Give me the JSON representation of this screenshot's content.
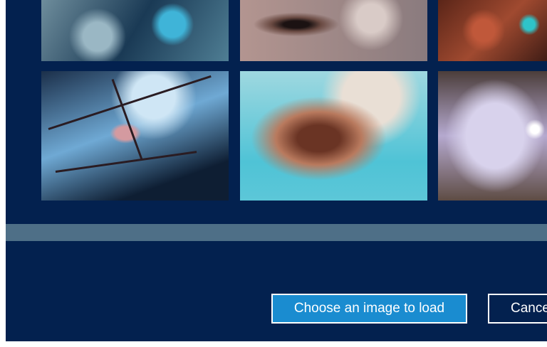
{
  "gallery": {
    "tiles": [
      {
        "name": "image-tile-1",
        "colors": [
          "#6e8d9c",
          "#3fb4d8"
        ]
      },
      {
        "name": "image-tile-2",
        "colors": [
          "#b39590",
          "#1b1212"
        ]
      },
      {
        "name": "image-tile-3",
        "colors": [
          "#a04a30",
          "#2ec4c9"
        ]
      },
      {
        "name": "image-tile-4",
        "colors": [
          "#6fa9d4",
          "#d49aa0"
        ]
      },
      {
        "name": "image-tile-5",
        "colors": [
          "#4fc3d6",
          "#b97a5e"
        ]
      },
      {
        "name": "image-tile-6",
        "colors": [
          "#b5a9cf",
          "#4b3d3a"
        ]
      }
    ]
  },
  "buttons": {
    "load_label": "Choose an image to load",
    "cancel_label": "Cance"
  },
  "colors": {
    "background": "#03214f",
    "scrollbar": "#4e6f87",
    "accent": "#1a8cd0"
  }
}
